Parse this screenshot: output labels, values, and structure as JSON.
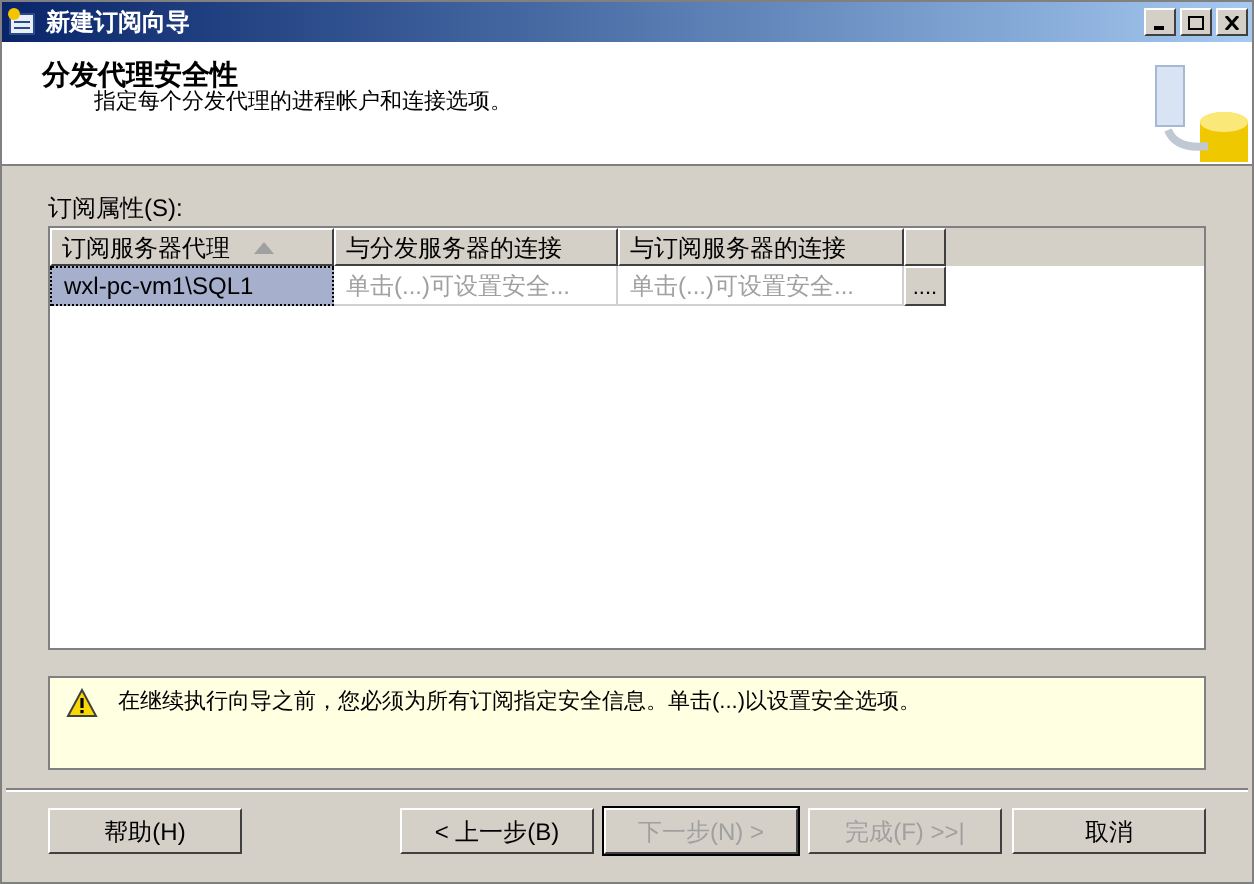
{
  "window": {
    "title": "新建订阅向导"
  },
  "header": {
    "title": "分发代理安全性",
    "subtitle": "指定每个分发代理的进程帐户和连接选项。"
  },
  "grid": {
    "label": "订阅属性(S):",
    "columns": [
      {
        "label": "订阅服务器代理",
        "sorted": true
      },
      {
        "label": "与分发服务器的连接",
        "sorted": false
      },
      {
        "label": "与订阅服务器的连接",
        "sorted": false
      }
    ],
    "rows": [
      {
        "selected": true,
        "cells": [
          "wxl-pc-vm1\\SQL1",
          "单击(...)可设置安全...",
          "单击(...)可设置安全..."
        ],
        "button": "...."
      }
    ]
  },
  "warning": {
    "message": "在继续执行向导之前，您必须为所有订阅指定安全信息。单击(...)以设置安全选项。"
  },
  "buttons": [
    {
      "label": "帮助(H)",
      "disabled": false
    },
    {
      "label": "< 上一步(B)",
      "disabled": false
    },
    {
      "label": "下一步(N) >",
      "disabled": true
    },
    {
      "label": "完成(F) >>|",
      "disabled": true
    },
    {
      "label": "取消",
      "disabled": false
    }
  ]
}
